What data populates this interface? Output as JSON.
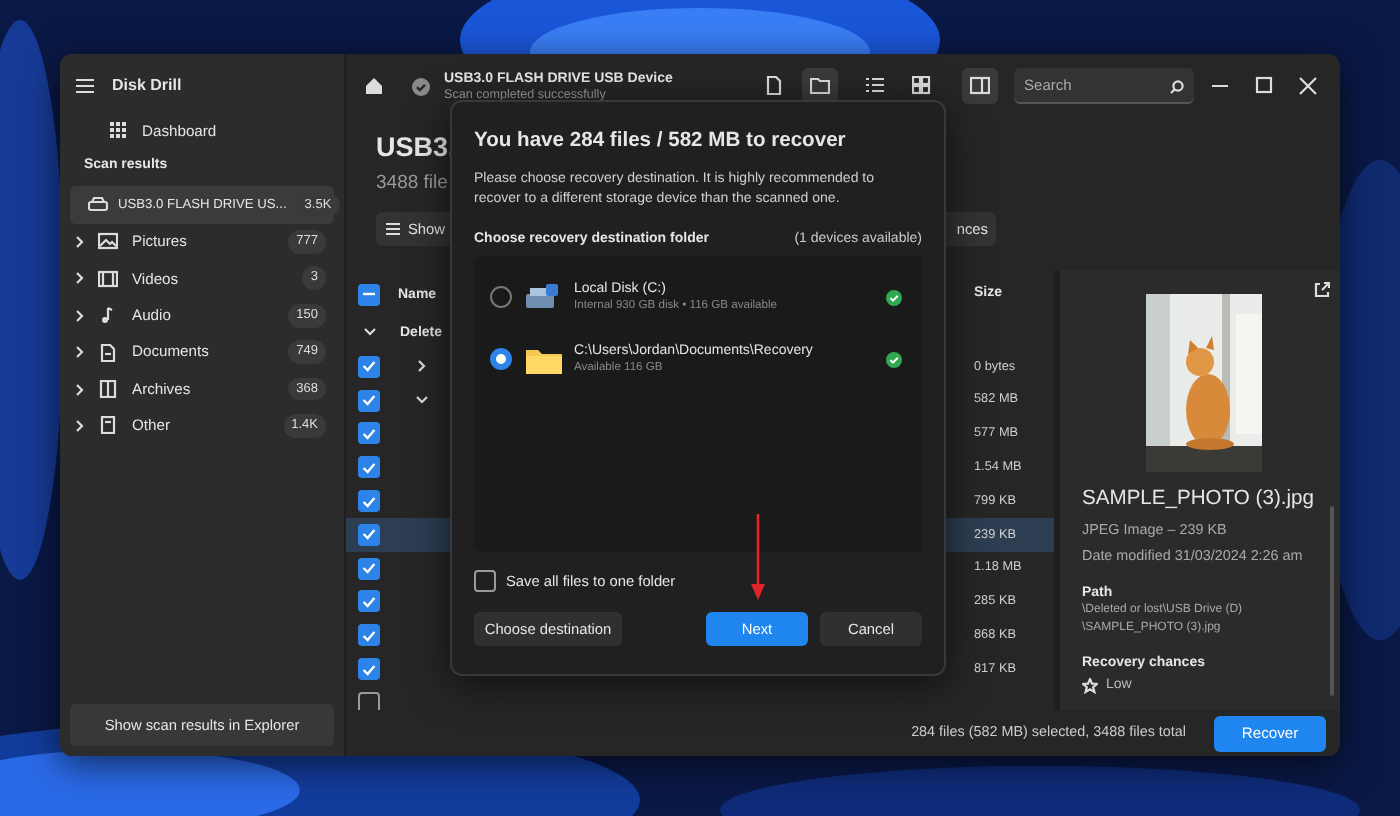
{
  "window": {
    "title": "Disk Drill"
  },
  "sidebar": {
    "dashboard": "Dashboard",
    "section": "Scan results",
    "items": [
      {
        "label": "USB3.0 FLASH DRIVE US...",
        "count": "3.5K",
        "selected": true
      },
      {
        "label": "Pictures",
        "count": "777",
        "selected": false
      },
      {
        "label": "Videos",
        "count": "3",
        "selected": false
      },
      {
        "label": "Audio",
        "count": "150",
        "selected": false
      },
      {
        "label": "Documents",
        "count": "749",
        "selected": false
      },
      {
        "label": "Archives",
        "count": "368",
        "selected": false
      },
      {
        "label": "Other",
        "count": "1.4K",
        "selected": false
      }
    ],
    "explorer_button": "Show scan results in Explorer"
  },
  "toolbar": {
    "title": "USB3.0 FLASH DRIVE USB Device",
    "subtitle": "Scan completed successfully",
    "views": [
      {
        "selected": false
      },
      {
        "selected": true
      },
      {
        "selected": false
      },
      {
        "selected": false
      },
      {
        "selected": true
      }
    ],
    "search": {
      "placeholder": "Search"
    }
  },
  "scan": {
    "title": "USB3.",
    "subtitle": "3488 file",
    "show_button": "Show",
    "partial_button": "nces"
  },
  "table": {
    "header": {
      "indeterminate": true,
      "name": "Name",
      "size": "Size"
    },
    "group": {
      "label": "Delete",
      "expanded": true
    },
    "rows": [
      {
        "checked": true,
        "expanded": false,
        "size": "0 bytes",
        "selected": false
      },
      {
        "checked": true,
        "expanded": true,
        "size": "582 MB",
        "selected": false
      },
      {
        "checked": true,
        "size": "577 MB",
        "selected": false
      },
      {
        "checked": true,
        "size": "1.54 MB",
        "selected": false
      },
      {
        "checked": true,
        "size": "799 KB",
        "selected": false
      },
      {
        "checked": true,
        "size": "239 KB",
        "selected": true
      },
      {
        "checked": true,
        "size": "1.18 MB",
        "selected": false
      },
      {
        "checked": true,
        "size": "285 KB",
        "selected": false
      },
      {
        "checked": true,
        "size": "868 KB",
        "selected": false
      },
      {
        "checked": true,
        "size": "817 KB",
        "selected": false
      },
      {
        "checked": false,
        "selected": false
      }
    ]
  },
  "preview": {
    "file_name": "SAMPLE_PHOTO (3).jpg",
    "type": "JPEG Image – 239 KB",
    "modified": "Date modified 31/03/2024 2:26 am",
    "path_label": "Path",
    "path": [
      "\\Deleted or lost\\USB Drive (D)",
      "\\SAMPLE_PHOTO (3).jpg"
    ],
    "chances_label": "Recovery chances",
    "chances": "Low"
  },
  "status": {
    "selection": "284 files (582 MB) selected, 3488 files total",
    "recover": "Recover"
  },
  "dialog": {
    "title": "You have 284 files / 582 MB to recover",
    "description": "Please choose recovery destination. It is highly recommended to recover to a different storage device than the scanned one.",
    "section": "Choose recovery destination folder",
    "devices": "(1 devices available)",
    "destinations": [
      {
        "name": "Local Disk (C:)",
        "detail": "Internal 930 GB disk • 116 GB available",
        "selected": false
      },
      {
        "name": "C:\\Users\\Jordan\\Documents\\Recovery",
        "detail": "Available 116 GB",
        "selected": true
      }
    ],
    "one_folder": {
      "label": "Save all files to one folder",
      "checked": false
    },
    "buttons": [
      {
        "label": "Choose destination",
        "primary": false
      },
      {
        "label": "Next",
        "primary": true
      },
      {
        "label": "Cancel",
        "primary": false
      }
    ]
  }
}
